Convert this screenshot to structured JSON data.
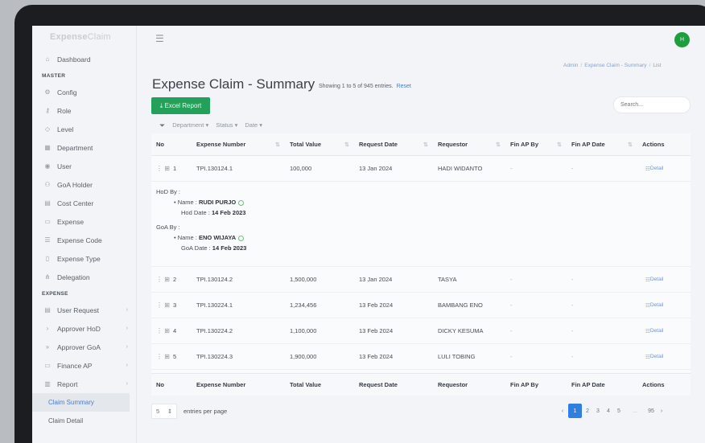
{
  "app": {
    "logo_strong": "Expense",
    "logo_light": "Claim",
    "avatar_initial": "H"
  },
  "sidebar": {
    "items_top": [
      {
        "label": "Dashboard",
        "icon": "home-icon"
      }
    ],
    "section_master": "MASTER",
    "master_items": [
      {
        "label": "Config",
        "icon": "gear-icon"
      },
      {
        "label": "Role",
        "icon": "key-icon"
      },
      {
        "label": "Level",
        "icon": "tag-icon"
      },
      {
        "label": "Department",
        "icon": "building-icon"
      },
      {
        "label": "User",
        "icon": "user-icon"
      },
      {
        "label": "GoA Holder",
        "icon": "users-icon"
      },
      {
        "label": "Cost Center",
        "icon": "grid-icon"
      },
      {
        "label": "Expense",
        "icon": "document-icon"
      },
      {
        "label": "Expense Code",
        "icon": "list-icon"
      },
      {
        "label": "Expense Type",
        "icon": "file-icon"
      },
      {
        "label": "Delegation",
        "icon": "sitemap-icon"
      }
    ],
    "section_expense": "EXPENSE",
    "expense_items": [
      {
        "label": "User Request",
        "icon": "clipboard-icon"
      },
      {
        "label": "Approver HoD",
        "icon": "chevron-right-icon"
      },
      {
        "label": "Approver GoA",
        "icon": "double-chevron-right-icon"
      },
      {
        "label": "Finance AP",
        "icon": "card-icon"
      },
      {
        "label": "Report",
        "icon": "bar-chart-icon"
      }
    ],
    "report_sub": [
      {
        "label": "Claim Summary",
        "active": true
      },
      {
        "label": "Claim Detail",
        "active": false
      }
    ]
  },
  "breadcrumb": {
    "admin": "Admin",
    "middle": "Expense Claim - Summary",
    "current": "List"
  },
  "page": {
    "title": "Expense Claim - Summary",
    "summary": "Showing 1 to 5 of 945 entries.",
    "reset": "Reset",
    "excel_button": "⤓ Excel Report",
    "search_placeholder": "Search...",
    "filters": [
      "Department",
      "Status",
      "Date"
    ]
  },
  "table": {
    "columns": [
      "No",
      "Expense Number",
      "Total Value",
      "Request Date",
      "Requestor",
      "Fin AP By",
      "Fin AP Date",
      "Actions"
    ],
    "detail_label": "Detail",
    "rows": [
      {
        "no": "1",
        "number": "TPI.130124.1",
        "value": "100,000",
        "date": "13 Jan 2024",
        "requestor": "HADI WIDANTO",
        "fin_by": "-",
        "fin_date": "-"
      },
      {
        "no": "2",
        "number": "TPI.130124.2",
        "value": "1,500,000",
        "date": "13 Jan 2024",
        "requestor": "TASYA",
        "fin_by": "-",
        "fin_date": "-"
      },
      {
        "no": "3",
        "number": "TPI.130224.1",
        "value": "1,234,456",
        "date": "13 Feb 2024",
        "requestor": "BAMBANG ENO",
        "fin_by": "-",
        "fin_date": "-"
      },
      {
        "no": "4",
        "number": "TPI.130224.2",
        "value": "1,100,000",
        "date": "13 Feb 2024",
        "requestor": "DICKY KESUMA",
        "fin_by": "-",
        "fin_date": "-"
      },
      {
        "no": "5",
        "number": "TPI.130224.3",
        "value": "1,900,000",
        "date": "13 Feb 2024",
        "requestor": "LULI TOBING",
        "fin_by": "-",
        "fin_date": "-"
      }
    ],
    "expanded": {
      "hod_label": "HoD By :",
      "hod_name_prefix": "Name :",
      "hod_name": "RUDI PURJO",
      "hod_date_prefix": "Hod Date :",
      "hod_date": "14 Feb 2023",
      "goa_label": "GoA By :",
      "goa_name_prefix": "Name :",
      "goa_name": "ENO WIJAYA",
      "goa_date_prefix": "GoA Date :",
      "goa_date": "14 Feb 2023"
    }
  },
  "footer": {
    "per_page_value": "5",
    "per_page_label": "entries per page",
    "pages": [
      "1",
      "2",
      "3",
      "4",
      "5"
    ],
    "ellipsis": "...",
    "last_page": "95",
    "prev": "‹",
    "next": "›"
  }
}
